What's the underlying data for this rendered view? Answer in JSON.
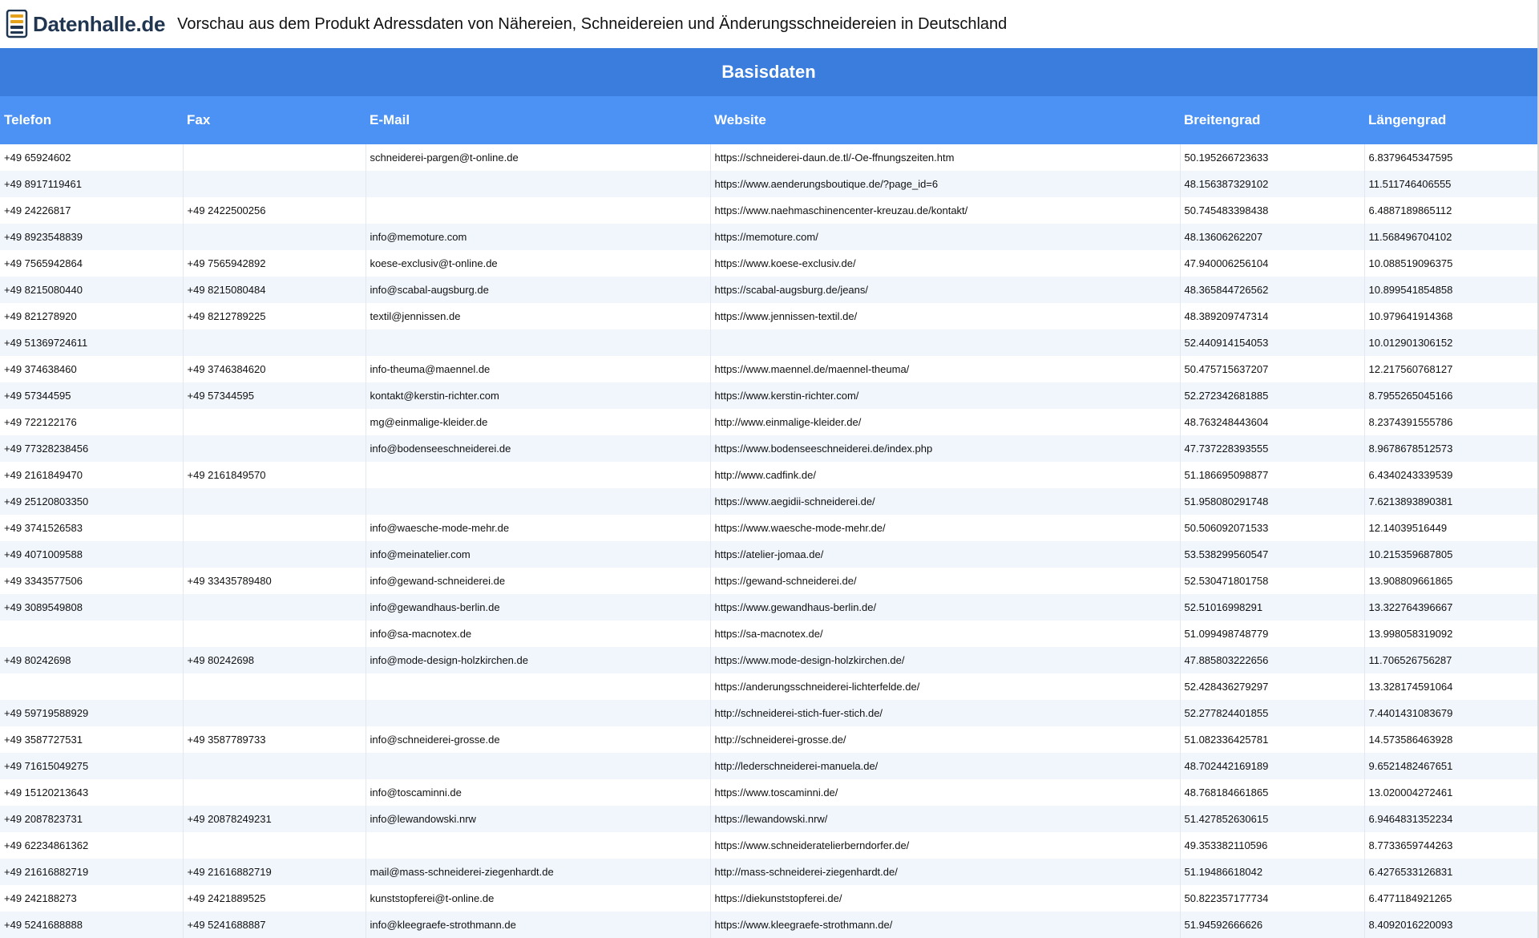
{
  "header": {
    "logo_text": "Datenhalle.de",
    "title": "Vorschau aus dem Produkt Adressdaten von Nähereien, Schneidereien und Änderungsschneidereien in Deutschland"
  },
  "section": {
    "title": "Basisdaten"
  },
  "table": {
    "columns": [
      "Telefon",
      "Fax",
      "E-Mail",
      "Website",
      "Breitengrad",
      "Längengrad"
    ],
    "rows": [
      [
        "+49 65924602",
        "",
        "schneiderei-pargen@t-online.de",
        "https://schneiderei-daun.de.tl/-Oe-ffnungszeiten.htm",
        "50.195266723633",
        "6.8379645347595"
      ],
      [
        "+49 8917119461",
        "",
        "",
        "https://www.aenderungsboutique.de/?page_id=6",
        "48.156387329102",
        "11.511746406555"
      ],
      [
        "+49 24226817",
        "+49 2422500256",
        "",
        "https://www.naehmaschinencenter-kreuzau.de/kontakt/",
        "50.745483398438",
        "6.4887189865112"
      ],
      [
        "+49 8923548839",
        "",
        "info@memoture.com",
        "https://memoture.com/",
        "48.13606262207",
        "11.568496704102"
      ],
      [
        "+49 7565942864",
        "+49 7565942892",
        "koese-exclusiv@t-online.de",
        "https://www.koese-exclusiv.de/",
        "47.940006256104",
        "10.088519096375"
      ],
      [
        "+49 8215080440",
        "+49 8215080484",
        "info@scabal-augsburg.de",
        "https://scabal-augsburg.de/jeans/",
        "48.365844726562",
        "10.899541854858"
      ],
      [
        "+49 821278920",
        "+49 8212789225",
        "textil@jennissen.de",
        "https://www.jennissen-textil.de/",
        "48.389209747314",
        "10.979641914368"
      ],
      [
        "+49 51369724611",
        "",
        "",
        "",
        "52.440914154053",
        "10.012901306152"
      ],
      [
        "+49 374638460",
        "+49 3746384620",
        "info-theuma@maennel.de",
        "https://www.maennel.de/maennel-theuma/",
        "50.475715637207",
        "12.217560768127"
      ],
      [
        "+49 57344595",
        "+49 57344595",
        "kontakt@kerstin-richter.com",
        "https://www.kerstin-richter.com/",
        "52.272342681885",
        "8.7955265045166"
      ],
      [
        "+49 722122176",
        "",
        "mg@einmalige-kleider.de",
        "http://www.einmalige-kleider.de/",
        "48.763248443604",
        "8.2374391555786"
      ],
      [
        "+49 77328238456",
        "",
        "info@bodenseeschneiderei.de",
        "https://www.bodenseeschneiderei.de/index.php",
        "47.737228393555",
        "8.9678678512573"
      ],
      [
        "+49 2161849470",
        "+49 2161849570",
        "",
        "http://www.cadfink.de/",
        "51.186695098877",
        "6.4340243339539"
      ],
      [
        "+49 25120803350",
        "",
        "",
        "https://www.aegidii-schneiderei.de/",
        "51.958080291748",
        "7.6213893890381"
      ],
      [
        "+49 3741526583",
        "",
        "info@waesche-mode-mehr.de",
        "https://www.waesche-mode-mehr.de/",
        "50.506092071533",
        "12.14039516449"
      ],
      [
        "+49 4071009588",
        "",
        "info@meinatelier.com",
        "https://atelier-jomaa.de/",
        "53.538299560547",
        "10.215359687805"
      ],
      [
        "+49 3343577506",
        "+49 33435789480",
        "info@gewand-schneiderei.de",
        "https://gewand-schneiderei.de/",
        "52.530471801758",
        "13.908809661865"
      ],
      [
        "+49 3089549808",
        "",
        "info@gewandhaus-berlin.de",
        "https://www.gewandhaus-berlin.de/",
        "52.51016998291",
        "13.322764396667"
      ],
      [
        "",
        "",
        "info@sa-macnotex.de",
        "https://sa-macnotex.de/",
        "51.099498748779",
        "13.998058319092"
      ],
      [
        "+49 80242698",
        "+49 80242698",
        "info@mode-design-holzkirchen.de",
        "https://www.mode-design-holzkirchen.de/",
        "47.885803222656",
        "11.706526756287"
      ],
      [
        "",
        "",
        "",
        "https://anderungsschneiderei-lichterfelde.de/",
        "52.428436279297",
        "13.328174591064"
      ],
      [
        "+49 59719588929",
        "",
        "",
        "http://schneiderei-stich-fuer-stich.de/",
        "52.277824401855",
        "7.4401431083679"
      ],
      [
        "+49 3587727531",
        "+49 3587789733",
        "info@schneiderei-grosse.de",
        "http://schneiderei-grosse.de/",
        "51.082336425781",
        "14.573586463928"
      ],
      [
        "+49 71615049275",
        "",
        "",
        "http://lederschneiderei-manuela.de/",
        "48.702442169189",
        "9.6521482467651"
      ],
      [
        "+49 15120213643",
        "",
        "info@toscaminni.de",
        "https://www.toscaminni.de/",
        "48.768184661865",
        "13.020004272461"
      ],
      [
        "+49 2087823731",
        "+49 20878249231",
        "info@lewandowski.nrw",
        "https://lewandowski.nrw/",
        "51.427852630615",
        "6.9464831352234"
      ],
      [
        "+49 62234861362",
        "",
        "",
        "https://www.schneideratelierberndorfer.de/",
        "49.353382110596",
        "8.7733659744263"
      ],
      [
        "+49 21616882719",
        "+49 21616882719",
        "mail@mass-schneiderei-ziegenhardt.de",
        "http://mass-schneiderei-ziegenhardt.de/",
        "51.19486618042",
        "6.4276533126831"
      ],
      [
        "+49 242188273",
        "+49 2421889525",
        "kunststopferei@t-online.de",
        "https://diekunststopferei.de/",
        "50.822357177734",
        "6.4771184921265"
      ],
      [
        "+49 5241688888",
        "+49 5241688887",
        "info@kleegraefe-strothmann.de",
        "https://www.kleegraefe-strothmann.de/",
        "51.94592666626",
        "8.4092016220093"
      ]
    ]
  }
}
